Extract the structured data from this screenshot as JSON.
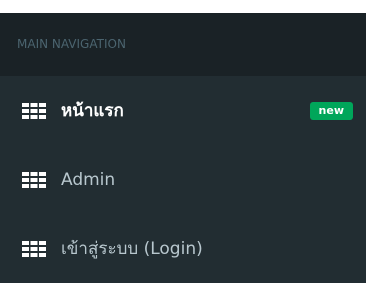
{
  "sidebar": {
    "header": "MAIN NAVIGATION",
    "items": [
      {
        "label": "หน้าแรก",
        "icon": "th-grid-icon",
        "badge": "new",
        "badge_color": "#00a65a",
        "active": true
      },
      {
        "label": "Admin",
        "icon": "th-grid-icon",
        "active": false
      },
      {
        "label": "เข้าสู่ระบบ (Login)",
        "icon": "th-grid-icon",
        "active": false
      }
    ]
  },
  "colors": {
    "sidebar_bg": "#222d32",
    "header_bg": "#1a2226",
    "header_text": "#4b646f",
    "item_text": "#b8c7ce",
    "active_text": "#ffffff",
    "badge_bg": "#00a65a"
  }
}
